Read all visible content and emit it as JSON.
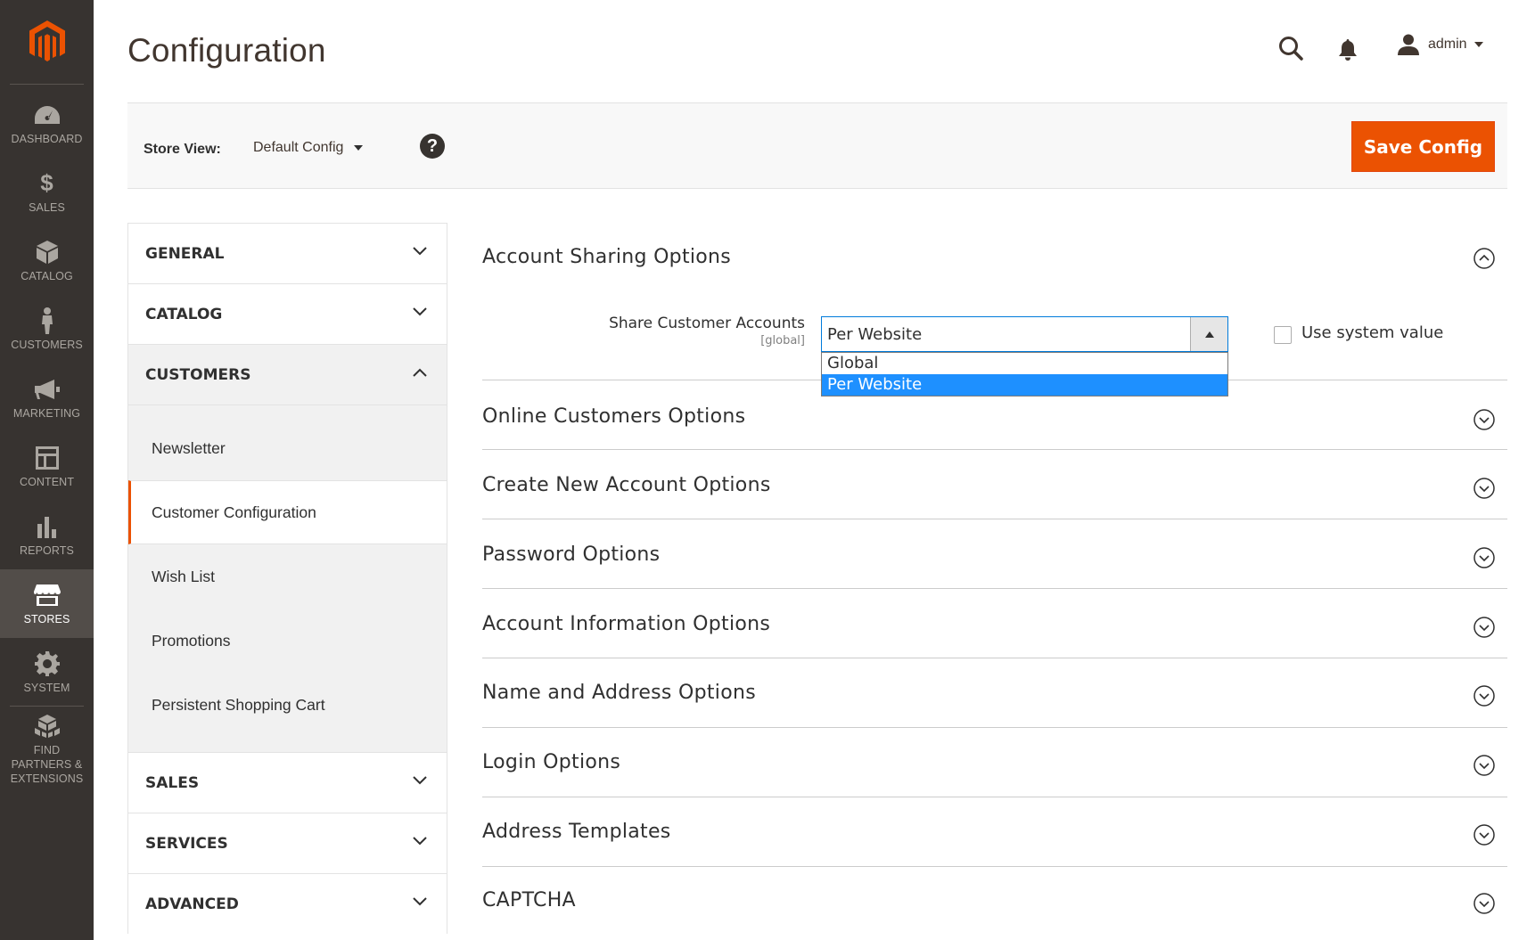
{
  "sidebar": {
    "items": [
      {
        "label": "DASHBOARD",
        "icon": "dashboard-icon"
      },
      {
        "label": "$",
        "sub": "SALES",
        "icon": "dollar-icon"
      },
      {
        "label": "CATALOG",
        "icon": "cube-icon"
      },
      {
        "label": "CUSTOMERS",
        "icon": "person-icon"
      },
      {
        "label": "MARKETING",
        "icon": "megaphone-icon"
      },
      {
        "label": "CONTENT",
        "icon": "layout-icon"
      },
      {
        "label": "REPORTS",
        "icon": "bar-chart-icon"
      },
      {
        "label": "STORES",
        "icon": "storefront-icon"
      },
      {
        "label": "SYSTEM",
        "icon": "gear-icon"
      },
      {
        "label": "FIND PARTNERS & EXTENSIONS",
        "icon": "boxes-icon"
      }
    ],
    "active": "STORES",
    "accent": "#eb5202"
  },
  "header": {
    "title": "Configuration",
    "user": "admin"
  },
  "toolbar": {
    "store_view_label": "Store View:",
    "store_view_value": "Default Config",
    "help": "?",
    "save_label": "Save Config"
  },
  "config_nav": {
    "groups": [
      {
        "label": "GENERAL"
      },
      {
        "label": "CATALOG"
      },
      {
        "label": "CUSTOMERS"
      },
      {
        "label": "SALES"
      },
      {
        "label": "SERVICES"
      },
      {
        "label": "ADVANCED"
      }
    ],
    "customers_items": [
      {
        "label": "Newsletter"
      },
      {
        "label": "Customer Configuration"
      },
      {
        "label": "Wish List"
      },
      {
        "label": "Promotions"
      },
      {
        "label": "Persistent Shopping Cart"
      }
    ],
    "active_item": "Customer Configuration"
  },
  "sections": [
    {
      "title": "Account Sharing Options",
      "expanded": true
    },
    {
      "title": "Online Customers Options"
    },
    {
      "title": "Create New Account Options"
    },
    {
      "title": "Password Options"
    },
    {
      "title": "Account Information Options"
    },
    {
      "title": "Name and Address Options"
    },
    {
      "title": "Login Options"
    },
    {
      "title": "Address Templates"
    },
    {
      "title": "CAPTCHA"
    }
  ],
  "account_sharing": {
    "field_label": "Share Customer Accounts",
    "scope": "[global]",
    "value": "Per Website",
    "options": [
      "Global",
      "Per Website"
    ],
    "selected_option": "Per Website",
    "use_system_value_label": "Use system value",
    "use_system_value_checked": false
  }
}
